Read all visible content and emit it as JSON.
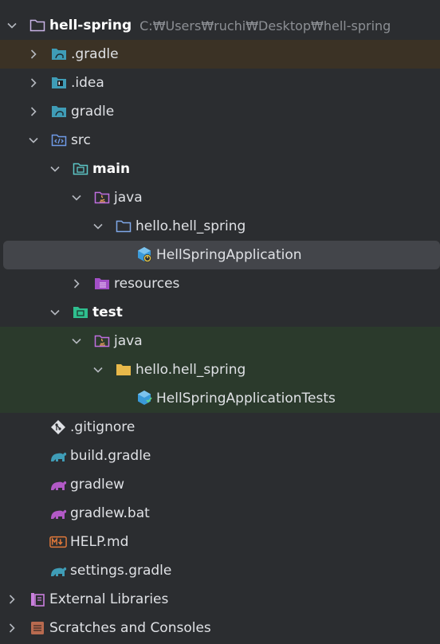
{
  "root": {
    "name": "hell-spring",
    "path": "C:₩Users₩ruchi₩Desktop₩hell-spring"
  },
  "items": [
    {
      "label": ".gradle"
    },
    {
      "label": ".idea"
    },
    {
      "label": "gradle"
    },
    {
      "label": "src"
    },
    {
      "label": "main"
    },
    {
      "label": "java"
    },
    {
      "label": "hello.hell_spring"
    },
    {
      "label": "HellSpringApplication"
    },
    {
      "label": "resources"
    },
    {
      "label": "test"
    },
    {
      "label": "java"
    },
    {
      "label": "hello.hell_spring"
    },
    {
      "label": "HellSpringApplicationTests"
    },
    {
      "label": ".gitignore"
    },
    {
      "label": "build.gradle"
    },
    {
      "label": "gradlew"
    },
    {
      "label": "gradlew.bat"
    },
    {
      "label": "HELP.md"
    },
    {
      "label": "settings.gradle"
    },
    {
      "label": "External Libraries"
    },
    {
      "label": "Scratches and Consoles"
    }
  ],
  "colors": {
    "background": "#2b2d30",
    "selected": "#43454a",
    "excluded": "#3b3225",
    "test": "#2b3a2c",
    "text": "#dfe1e5"
  }
}
